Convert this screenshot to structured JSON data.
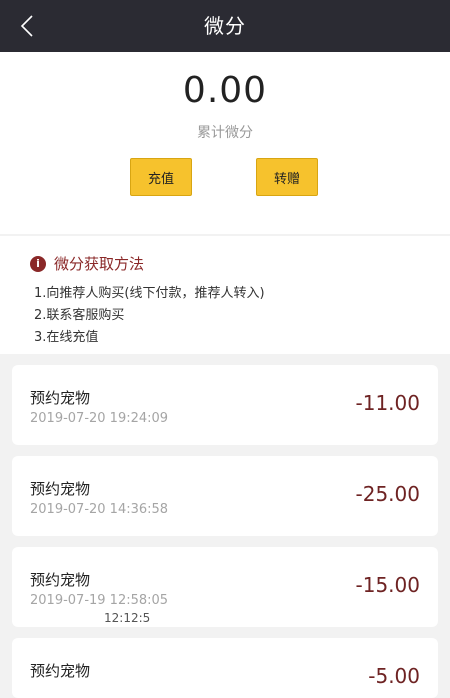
{
  "header": {
    "title": "微分",
    "back_icon": "chevron-left-icon"
  },
  "balance": {
    "amount": "0.00",
    "label": "累计微分"
  },
  "actions": {
    "recharge_label": "充值",
    "transfer_label": "转赠"
  },
  "info": {
    "title": "微分获取方法",
    "lines": [
      "1.向推荐人购买(线下付款，推荐人转入)",
      "2.联系客服购买",
      "3.在线充值"
    ]
  },
  "records": [
    {
      "name": "预约宠物",
      "time": "2019-07-20 19:24:09",
      "value": "-11.00"
    },
    {
      "name": "预约宠物",
      "time": "2019-07-20 14:36:58",
      "value": "-25.00"
    },
    {
      "name": "预约宠物",
      "time": "2019-07-19 12:58:05",
      "value": "-15.00"
    },
    {
      "name": "预约宠物",
      "time": "",
      "value": "-5.00"
    }
  ],
  "overlay": {
    "time_text": "12:12:5"
  },
  "colors": {
    "nav_bg": "#2b2b33",
    "button_bg": "#f6c22d",
    "accent_dark_red": "#8a2828",
    "negative_value": "#6e2323"
  }
}
